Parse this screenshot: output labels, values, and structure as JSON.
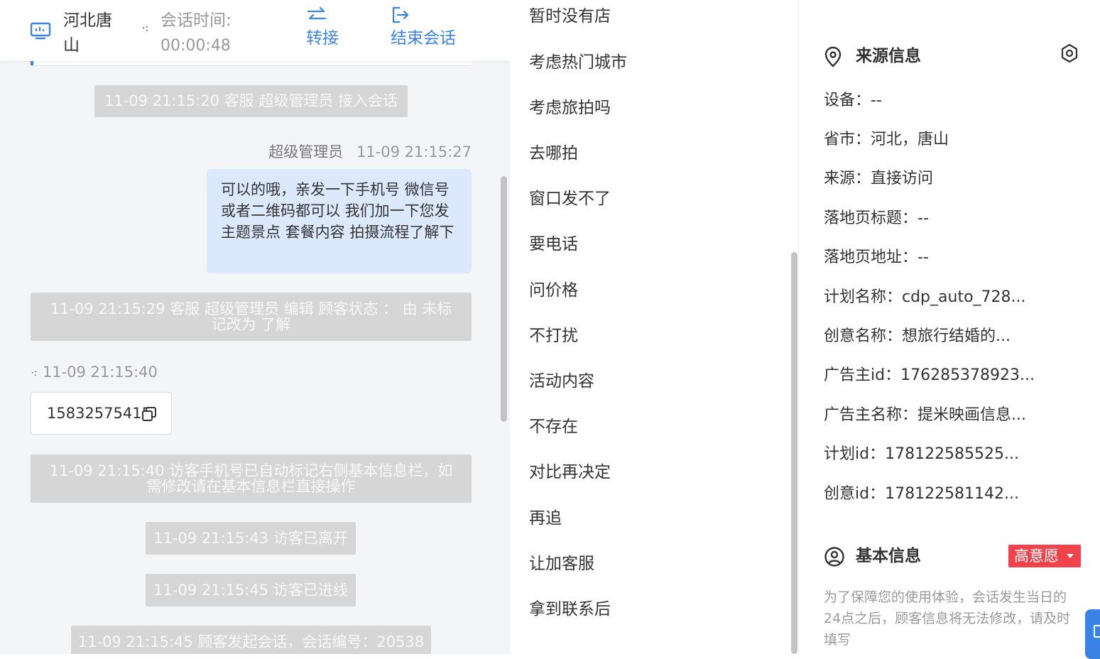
{
  "header": {
    "visitor_name": "河北唐山",
    "status_dot": "·:",
    "session_time_label": "会话时间:",
    "session_time_value": "00:00:48",
    "transfer_label": "转接",
    "end_label": "结束会话",
    "accent_color": "#3b82e6"
  },
  "chat": {
    "sys_accept": "11-09 21:15:20 客服 超级管理员 接入会话",
    "agent_name": "超级管理员",
    "agent_time": "11-09 21:15:27",
    "agent_message": "可以的哦，亲发一下手机号 微信号或者二维码都可以 我们加一下您发主题景点 套餐内容 拍摄流程了解下",
    "sys_edit": "11-09 21:15:29 客服 超级管理员 编辑 顾客状态 ： 由 未标记改为 了解",
    "visitor_dot": "·:",
    "visitor_time": "11-09 21:15:40",
    "visitor_phone": "15832575415",
    "sys_autotag": "11-09 21:15:40 访客手机号已自动标记右侧基本信息栏，如需修改请在基本信息栏直接操作",
    "sys_left": "11-09 21:15:43 访客已离开",
    "sys_joined": "11-09 21:15:45 访客已进线",
    "sys_started": "11-09 21:15:45 顾客发起会话，会话编号：20538"
  },
  "quick_replies": [
    "暂时没有店",
    "考虑热门城市",
    "考虑旅拍吗",
    "去哪拍",
    "窗口发不了",
    "要电话",
    "问价格",
    "不打扰",
    "活动内容",
    "不存在",
    "对比再决定",
    "再追",
    "让加客服",
    "拿到联系后"
  ],
  "source_info": {
    "title": "来源信息",
    "rows": [
      "设备：--",
      "省市：河北，唐山",
      "来源：直接访问",
      "落地页标题：--",
      "落地页地址：--",
      "计划名称：cdp_auto_728...",
      "创意名称：想旅行结婚的...",
      "广告主id：176285378923...",
      "广告主名称：提米映画信息...",
      "计划id：178122585525...",
      "创意id：178122581142..."
    ]
  },
  "basic_info": {
    "title": "基本信息",
    "intent_label": "高意愿",
    "intent_color": "#f0424a",
    "notice": "为了保障您的使用体验，会话发生当日的24点之后，顾客信息将无法修改，请及时填写"
  }
}
